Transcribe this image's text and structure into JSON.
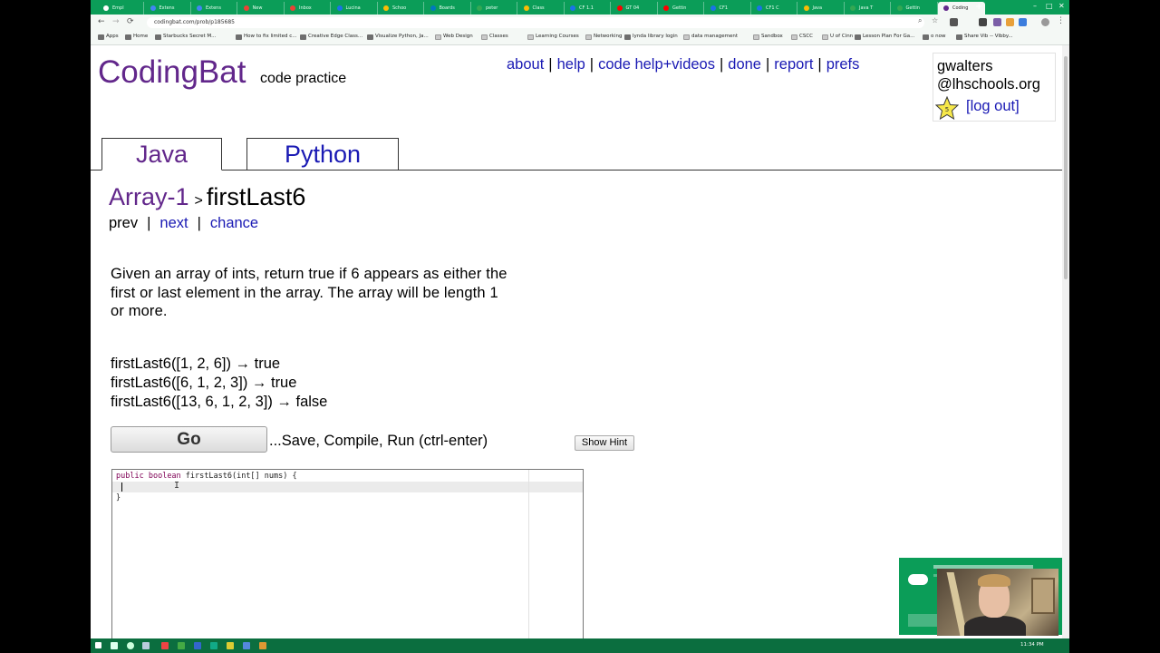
{
  "browser": {
    "tabs": [
      {
        "label": "Empl",
        "color": "#ffffff"
      },
      {
        "label": "Extens",
        "color": "#4285f4"
      },
      {
        "label": "Extens",
        "color": "#4285f4"
      },
      {
        "label": "New",
        "color": "#ea4335"
      },
      {
        "label": "Inbox",
        "color": "#ea4335"
      },
      {
        "label": "Lucina",
        "color": "#1a73e8"
      },
      {
        "label": "Schoo",
        "color": "#fbbc04"
      },
      {
        "label": "Boards",
        "color": "#0079bf"
      },
      {
        "label": "peter",
        "color": "#34a853"
      },
      {
        "label": "Class",
        "color": "#fbbc04"
      },
      {
        "label": "CF 1.1",
        "color": "#1a73e8"
      },
      {
        "label": "GT 04",
        "color": "#ff0000"
      },
      {
        "label": "Gettin",
        "color": "#ff0000"
      },
      {
        "label": "CF1",
        "color": "#1a73e8"
      },
      {
        "label": "CF1 C",
        "color": "#1a73e8"
      },
      {
        "label": "Java",
        "color": "#fbbc04"
      },
      {
        "label": "Java T",
        "color": "#34a853"
      },
      {
        "label": "Gettin",
        "color": "#34a853"
      },
      {
        "label": "Coding",
        "color": "#62278b",
        "active": true
      }
    ],
    "url": "codingbat.com/prob/p185685",
    "bookmarks": [
      {
        "label": "Apps",
        "type": "apps"
      },
      {
        "label": "Home",
        "type": "link"
      },
      {
        "label": "Starbucks Secret M...",
        "type": "link"
      },
      {
        "label": "How to fix limited c...",
        "type": "link"
      },
      {
        "label": "Creative Edge Class...",
        "type": "link"
      },
      {
        "label": "Visualize Python, Ja...",
        "type": "link"
      },
      {
        "label": "Web Design",
        "type": "folder"
      },
      {
        "label": "Classes",
        "type": "folder"
      },
      {
        "label": "Learning Courses",
        "type": "folder"
      },
      {
        "label": "Networking",
        "type": "folder"
      },
      {
        "label": "lynda library login",
        "type": "link"
      },
      {
        "label": "data management",
        "type": "folder"
      },
      {
        "label": "Sandbox",
        "type": "folder"
      },
      {
        "label": "CSCC",
        "type": "folder"
      },
      {
        "label": "U of Cinn",
        "type": "folder"
      },
      {
        "label": "Lesson Plan For Ga...",
        "type": "link"
      },
      {
        "label": "o now",
        "type": "link"
      },
      {
        "label": "Share Vib -- Vibby...",
        "type": "link"
      }
    ]
  },
  "site": {
    "logo": "CodingBat",
    "tagline": "code practice",
    "nav": [
      "about",
      "help",
      "code help+videos",
      "done",
      "report",
      "prefs"
    ],
    "user": {
      "line1": "gwalters",
      "line2": "@lhschools.org",
      "logout": "[log out]",
      "star_count": "5"
    },
    "tabs": [
      "Java",
      "Python"
    ],
    "breadcrumb": {
      "category": "Array-1",
      "separator": ">",
      "problem": "firstLast6"
    },
    "problem_nav": {
      "prev": "prev",
      "next": "next",
      "chance": "chance",
      "sep": "|"
    },
    "description_lines": [
      "Given an array of ints, return true if 6 appears as either the",
      "first or last element in the array. The array will be length 1",
      "or more."
    ],
    "examples": [
      "firstLast6([1, 2, 6]) → true",
      "firstLast6([6, 1, 2, 3]) → true",
      "firstLast6([13, 6, 1, 2, 3]) → false"
    ],
    "go_label": "Go",
    "go_caption": "...Save, Compile, Run (ctrl-enter)",
    "hint_label": "Show Hint",
    "code": {
      "kw1": "public",
      "kw2": "boolean",
      "signature": " firstLast6(int[] nums) {",
      "close": "}"
    }
  },
  "taskbar": {
    "time": "11:34 PM"
  },
  "colors": {
    "brand_purple": "#62278b",
    "link_blue": "#1a1ab4",
    "chrome_green": "#0b9d58"
  }
}
